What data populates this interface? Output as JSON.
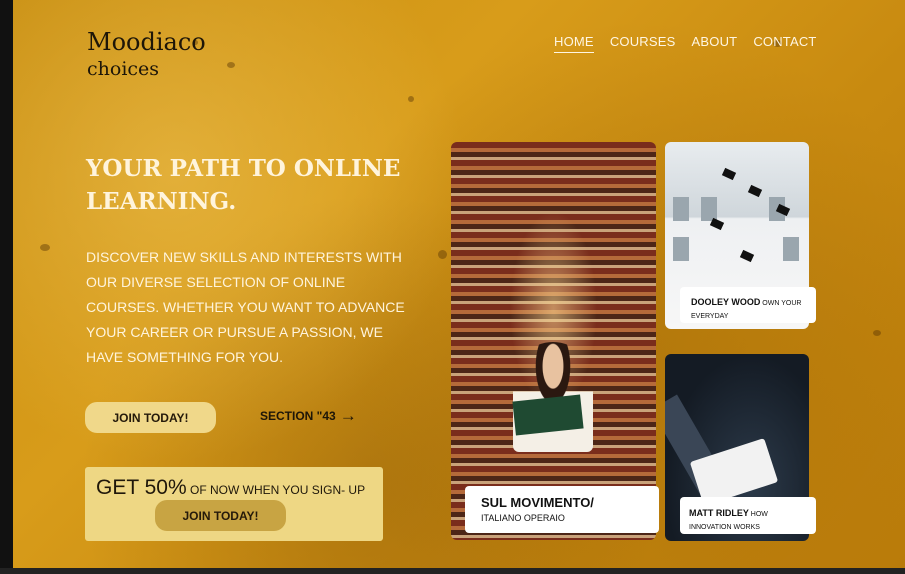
{
  "brand": {
    "name_line1": "Moodiaco",
    "name_line2": "choices"
  },
  "nav": {
    "items": [
      "HOME",
      "COURSES",
      "ABOUT",
      "CONTACT"
    ],
    "active": "HOME"
  },
  "hero": {
    "headline": "YOUR PATH TO ONLINE LEARNING.",
    "description": "DISCOVER NEW SKILLS AND INTERESTS WITH OUR DIVERSE SELECTION OF ONLINE COURSES. WHETHER YOU WANT TO ADVANCE YOUR CAREER OR PURSUE A PASSION, WE HAVE SOMETHING FOR YOU.",
    "join_label": "JOIN TODAY!",
    "section_link": "SECTION \"43"
  },
  "promo": {
    "big": "GET 50%",
    "small": " OF NOW WHEN YOU SIGN- UP",
    "button": "JOIN TODAY!"
  },
  "cards": {
    "library": {
      "title": "SUL MOVIMENTO/",
      "subtitle": "ITALIANO OPERAIO"
    },
    "graduation": {
      "title": "DOOLEY WOOD",
      "subtitle_inline": " OWN YOUR",
      "subtitle_line2": "EVERYDAY"
    },
    "lecture": {
      "title": "MATT RIDLEY",
      "subtitle_inline": " HOW",
      "subtitle_line2": "INNOVATION WORKS"
    }
  },
  "colors": {
    "background": "#d09416",
    "button": "#f0d88a",
    "promo_bg": "#eed784",
    "promo_button": "#c8a443",
    "text_light": "#fff4dc"
  },
  "icons": {
    "section_arrow": "arrow-right-icon"
  }
}
